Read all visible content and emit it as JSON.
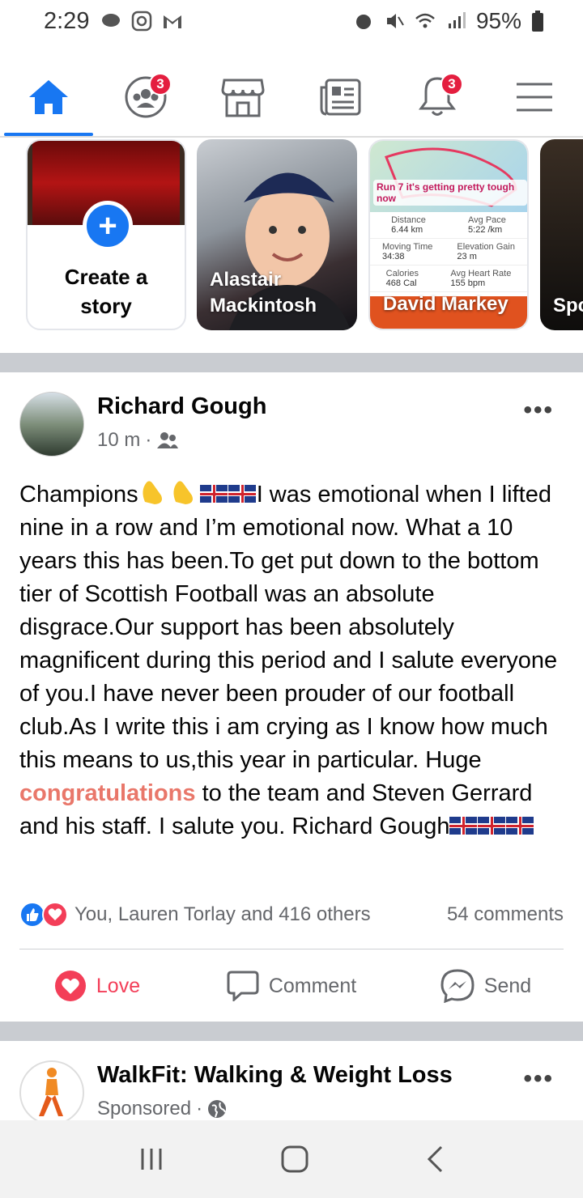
{
  "status_bar": {
    "time": "2:29",
    "battery": "95%"
  },
  "nav": {
    "tabs": [
      {
        "name": "home",
        "badge": ""
      },
      {
        "name": "groups",
        "badge": "3"
      },
      {
        "name": "marketplace",
        "badge": ""
      },
      {
        "name": "news",
        "badge": ""
      },
      {
        "name": "notifications",
        "badge": "3"
      },
      {
        "name": "menu",
        "badge": ""
      }
    ],
    "active": "home"
  },
  "stories": {
    "create_label_line1": "Create a",
    "create_label_line2": "story",
    "items": [
      {
        "name_line1": "Alastair",
        "name_line2": "Mackintosh"
      },
      {
        "name_line1": "David Markey",
        "caption": "Run 7 it's getting pretty tough now",
        "stats": [
          [
            "Distance",
            "6.44 km"
          ],
          [
            "Avg Pace",
            "5:22 /km"
          ],
          [
            "Moving Time",
            "34:38"
          ],
          [
            "Elevation Gain",
            "23 m"
          ],
          [
            "Calories",
            "468 Cal"
          ],
          [
            "Avg Heart Rate",
            "155 bpm"
          ]
        ]
      },
      {
        "name_line1": "Spo"
      }
    ]
  },
  "post": {
    "author": "Richard Gough",
    "time": "10 m",
    "text_1": "Champions",
    "text_2": "I was emotional when I lifted nine in a row and I’m emotional now. What a 10 years this has been.To get put down to the bottom tier of Scottish Football was an absolute disgrace.Our support has been absolutely magnificent during this period and I salute everyone of you.I have never been prouder of our football club.As I write this i am crying as I know how much this means to us,this year in particular. Huge ",
    "highlight": "congratulations",
    "text_3": " to the team and Steven Gerrard and his staff. I salute you. Richard Gough",
    "reactions_text": "You, Lauren Torlay and 416 others",
    "comments": "54 comments",
    "actions": {
      "love": "Love",
      "comment": "Comment",
      "send": "Send"
    }
  },
  "sponsored": {
    "title": "WalkFit: Walking & Weight Loss",
    "label": "Sponsored"
  },
  "colors": {
    "brand": "#1877f2",
    "love": "#f33e58",
    "highlight": "#e9776a"
  }
}
